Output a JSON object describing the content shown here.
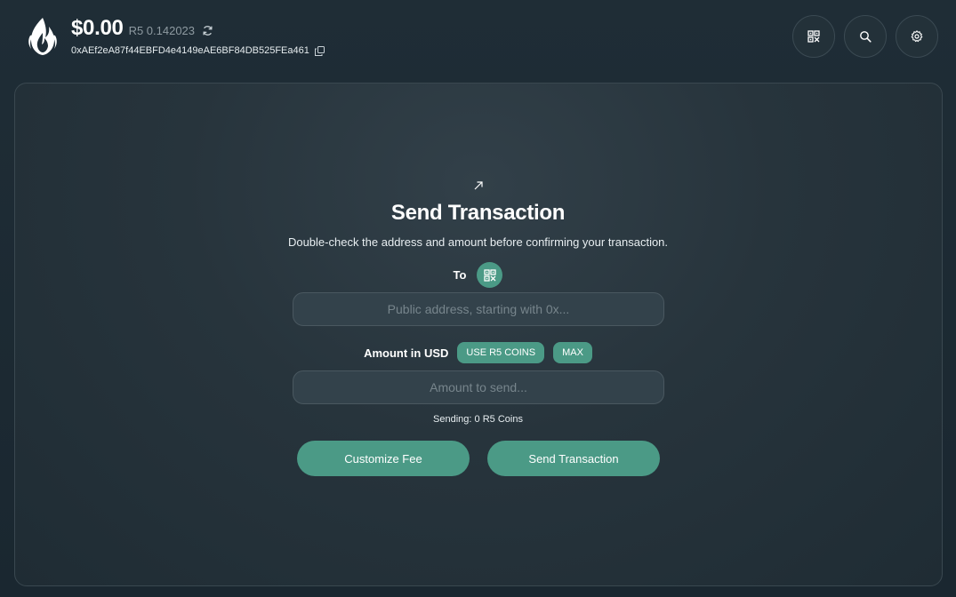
{
  "header": {
    "balance_usd": "$0.00",
    "balance_coins": "R5 0.142023",
    "wallet_address": "0xAEf2eA87f44EBFD4e4149eAE6BF84DB525FEa461",
    "icons": {
      "logo": "flame-logo-icon",
      "refresh": "refresh-icon",
      "copy": "copy-icon",
      "qr": "qr-code-icon",
      "search": "search-icon",
      "settings": "gear-icon"
    }
  },
  "send": {
    "icon": "arrow-up-right-icon",
    "title": "Send Transaction",
    "subtitle": "Double-check the address and amount before confirming your transaction.",
    "to_label": "To",
    "address_placeholder": "Public address, starting with 0x...",
    "amount_label": "Amount in USD",
    "use_coins_label": "USE R5 COINS",
    "max_label": "MAX",
    "amount_placeholder": "Amount to send...",
    "sending_text": "Sending: 0 R5 Coins",
    "customize_fee_label": "Customize Fee",
    "send_button_label": "Send Transaction"
  },
  "colors": {
    "accent": "#4b9a86",
    "background": "#1c2a33",
    "panel": "#27343c",
    "muted_text": "#8e9aa1"
  }
}
